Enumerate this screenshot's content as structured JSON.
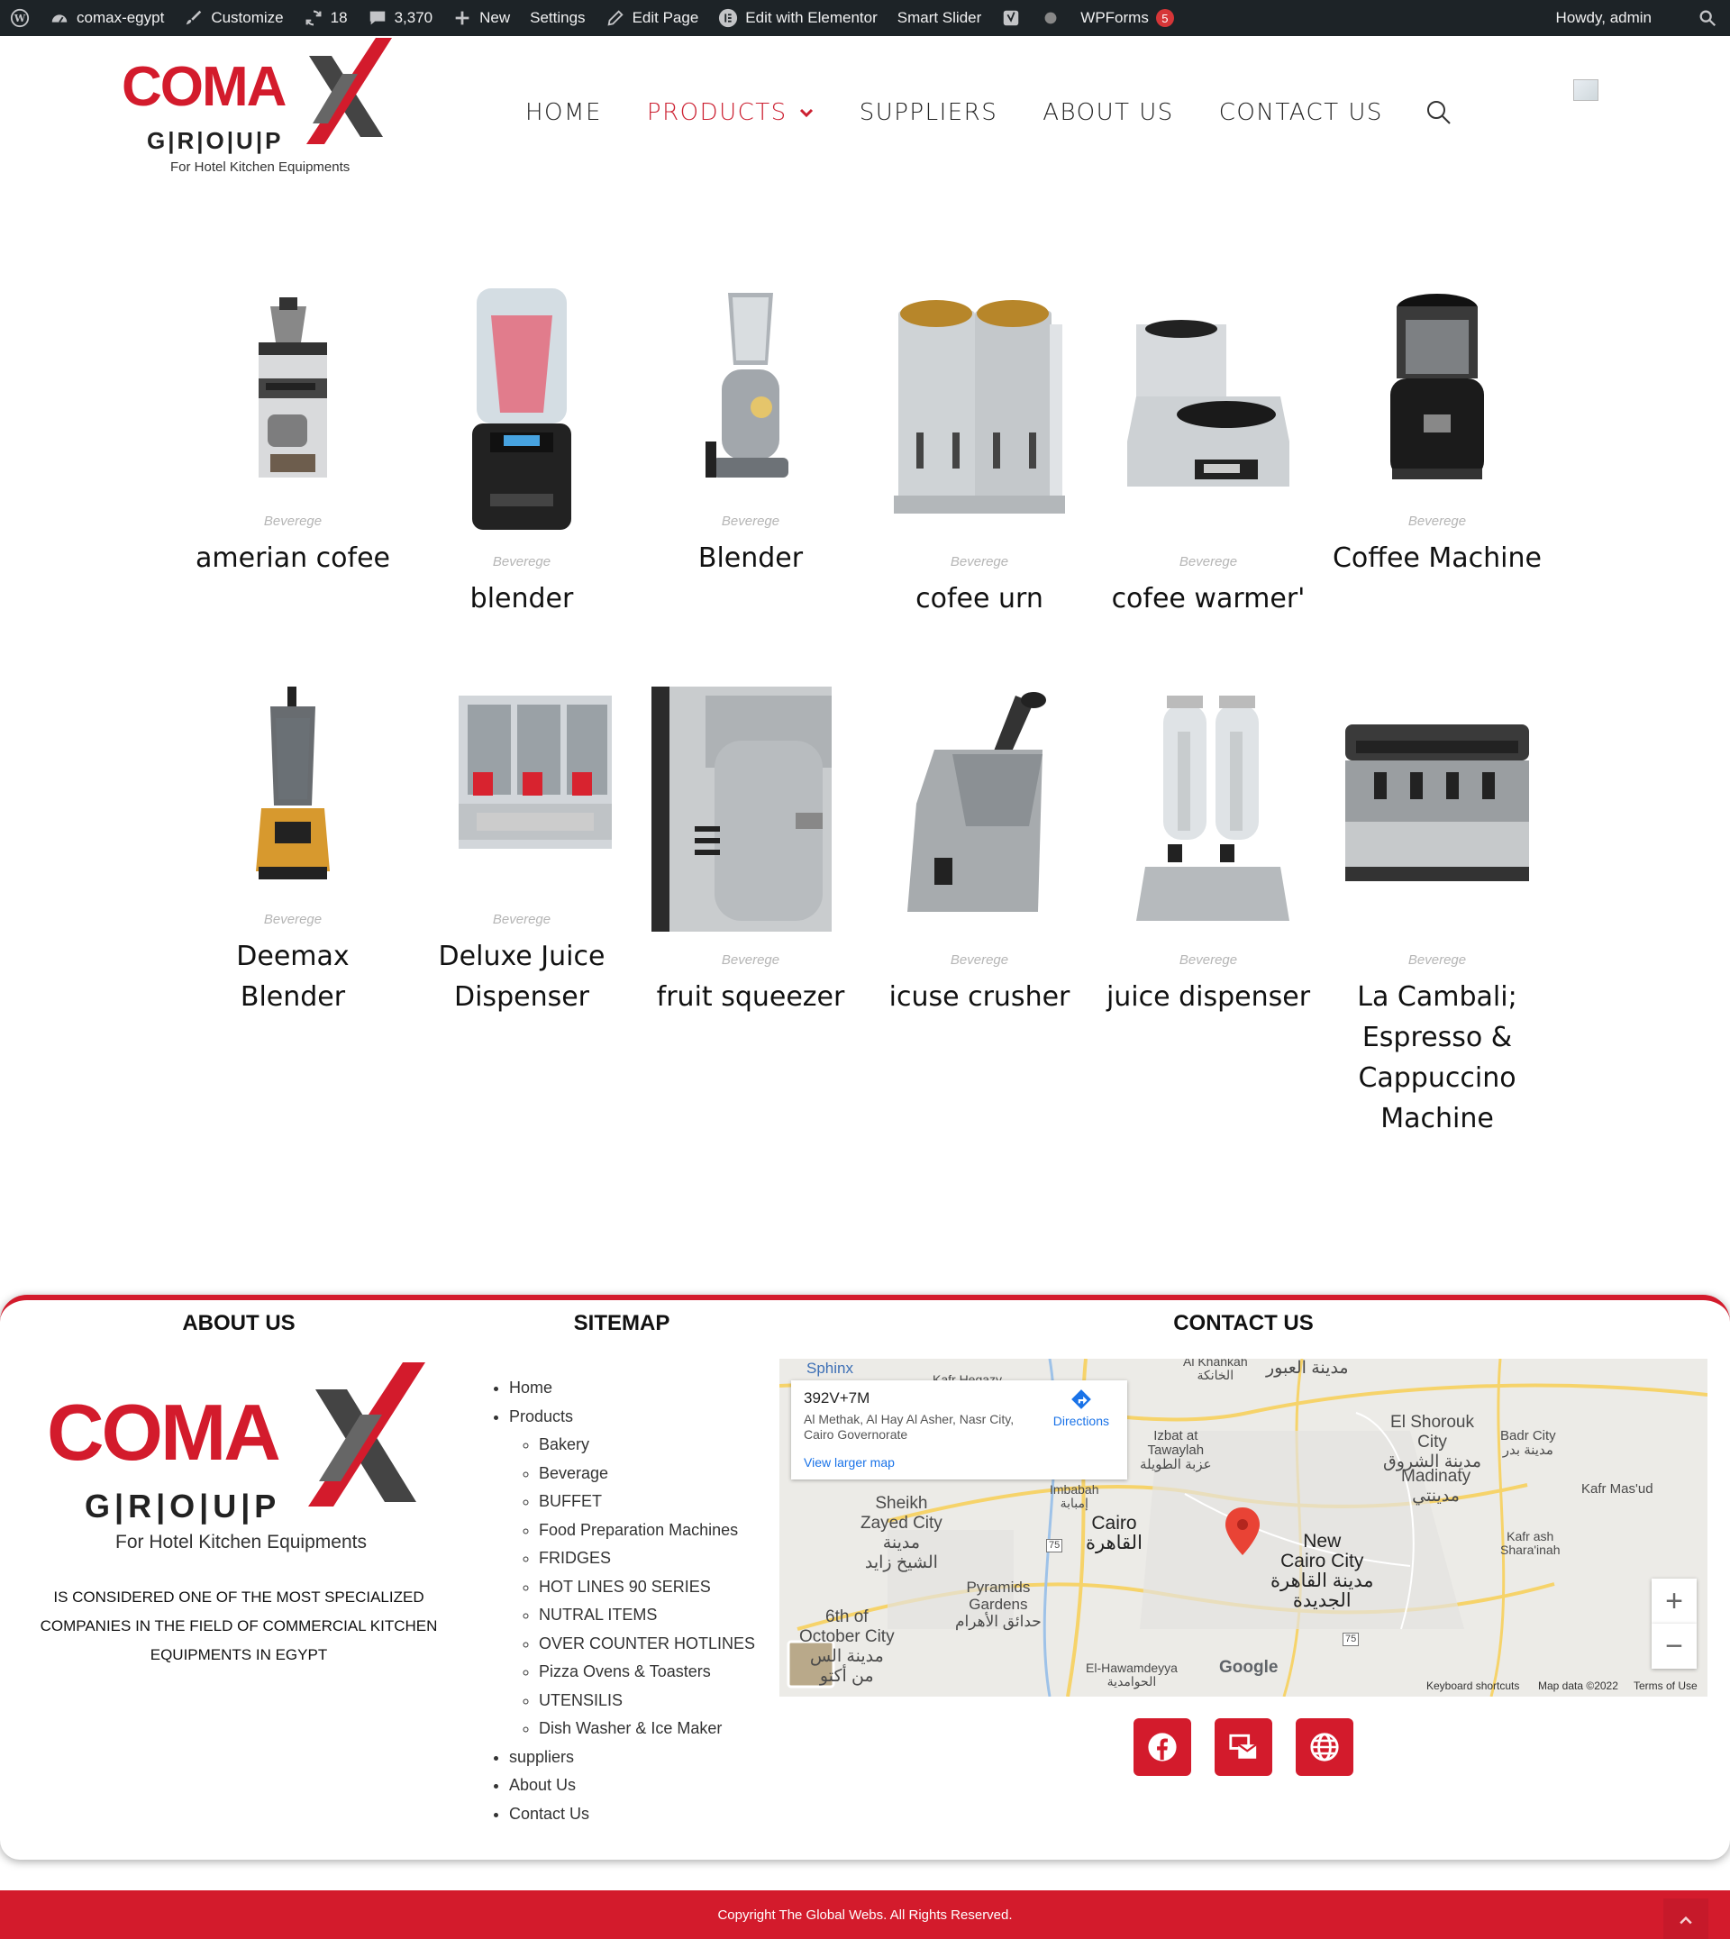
{
  "adminbar": {
    "site": "comax-egypt",
    "customize": "Customize",
    "updates": "18",
    "comments": "3,370",
    "new": "New",
    "settings": "Settings",
    "edit_page": "Edit Page",
    "elementor": "Edit with Elementor",
    "smart_slider": "Smart Slider",
    "wpforms": "WPForms",
    "wpforms_count": "5",
    "howdy": "Howdy, admin"
  },
  "logo": {
    "word": "COMA",
    "group": "G|R|O|U|P",
    "tagline": "For Hotel Kitchen Equipments"
  },
  "nav": {
    "home": "HOME",
    "products": "PRODUCTS",
    "suppliers": "SUPPLIERS",
    "about": "ABOUT US",
    "contact": "CONTACT US"
  },
  "products": [
    {
      "category": "Beverege",
      "name": "amerian cofee"
    },
    {
      "category": "Beverege",
      "name": "blender"
    },
    {
      "category": "Beverege",
      "name": "Blender"
    },
    {
      "category": "Beverege",
      "name": "cofee urn"
    },
    {
      "category": "Beverege",
      "name": "cofee warmer'"
    },
    {
      "category": "Beverege",
      "name": "Coffee Machine"
    },
    {
      "category": "Beverege",
      "name": "Deemax Blender"
    },
    {
      "category": "Beverege",
      "name": "Deluxe Juice Dispenser"
    },
    {
      "category": "Beverege",
      "name": "fruit squeezer"
    },
    {
      "category": "Beverege",
      "name": "icuse crusher"
    },
    {
      "category": "Beverege",
      "name": "juice dispenser"
    },
    {
      "category": "Beverege",
      "name": "La Cambali; Espresso & Cappuccino Machine"
    }
  ],
  "footer": {
    "about_heading": "ABOUT US",
    "sitemap_heading": "SITEMAP",
    "contact_heading": "CONTACT US",
    "about_text": "IS CONSIDERED ONE OF THE MOST SPECIALIZED COMPANIES IN THE FIELD OF COMMERCIAL KITCHEN EQUIPMENTS IN EGYPT",
    "sitemap": {
      "home": "Home",
      "products": "Products",
      "sub": [
        "Bakery",
        "Beverage",
        "BUFFET",
        "Food Preparation Machines",
        "FRIDGES",
        "HOT LINES 90 SERIES",
        "NUTRAL ITEMS",
        "OVER COUNTER HOTLINES",
        "Pizza Ovens & Toasters",
        "UTENSILIS",
        "Dish Washer & Ice Maker"
      ],
      "suppliers": "suppliers",
      "about": "About Us",
      "contact": "Contact Us"
    },
    "copyright": "Copyright The Global Webs. All Rights Reserved."
  },
  "map": {
    "plus_code": "392V+7M",
    "address": "Al Methak, Al Hay Al Asher, Nasr City, Cairo Governorate",
    "directions": "Directions",
    "view_larger": "View larger map",
    "keyboard": "Keyboard shortcuts",
    "map_data": "Map data ©2022",
    "terms": "Terms of Use",
    "google": "Google",
    "labels": {
      "sphinx": "Sphinx",
      "kafr_hegazy": "Kafr Hegazy",
      "khanka": "Al Khankah\nالخانكة",
      "obour": "مدينة العبور",
      "shorouk": "El Shorouk\nCity\nمدينة الشروق",
      "badr": "Badr City\nمدينة بدر",
      "izbat": "Izbat at\nTawaylah\nعزبة الطويلة",
      "madinaty": "Madinaty\nمدينتي",
      "kafr_masud": "Kafr Mas'ud",
      "sheikh_zayed": "Sheikh\nZayed City\nمدينة\nالشيخ زايد",
      "imbabah": "Imbabah\nإمبابة",
      "cairo": "Cairo\nالقاهرة",
      "new_cairo": "New\nCairo City\nمدينة القاهرة\nالجديدة",
      "kafr_ash": "Kafr ash\nShara'inah",
      "pyramids": "Pyramids\nGardens\nحدائق الأهرام",
      "october": "6th of\nOctober City\nمدينة الس\nمن أكتو",
      "hawamdeyya": "El-Hawamdeyya\nالحوامدية",
      "r75a": "75",
      "r75b": "75"
    }
  },
  "colors": {
    "brand_red": "#d31b2c",
    "admin_bar": "#1d2327",
    "active_nav": "#cc2031"
  }
}
